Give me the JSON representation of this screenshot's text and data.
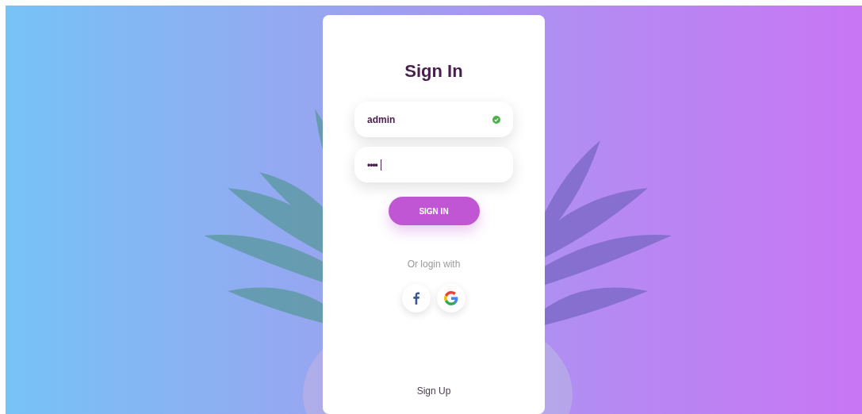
{
  "title": "Sign In",
  "fields": [
    {
      "kind": "text",
      "value": "admin",
      "valid": true
    },
    {
      "kind": "password",
      "value": "••••",
      "valid": false
    }
  ],
  "submit": {
    "label": "SIGN IN"
  },
  "social": {
    "caption": "Or login with",
    "buttons": [
      {
        "kind": "facebook"
      },
      {
        "kind": "google"
      }
    ]
  },
  "signup": {
    "label": "Sign Up"
  }
}
